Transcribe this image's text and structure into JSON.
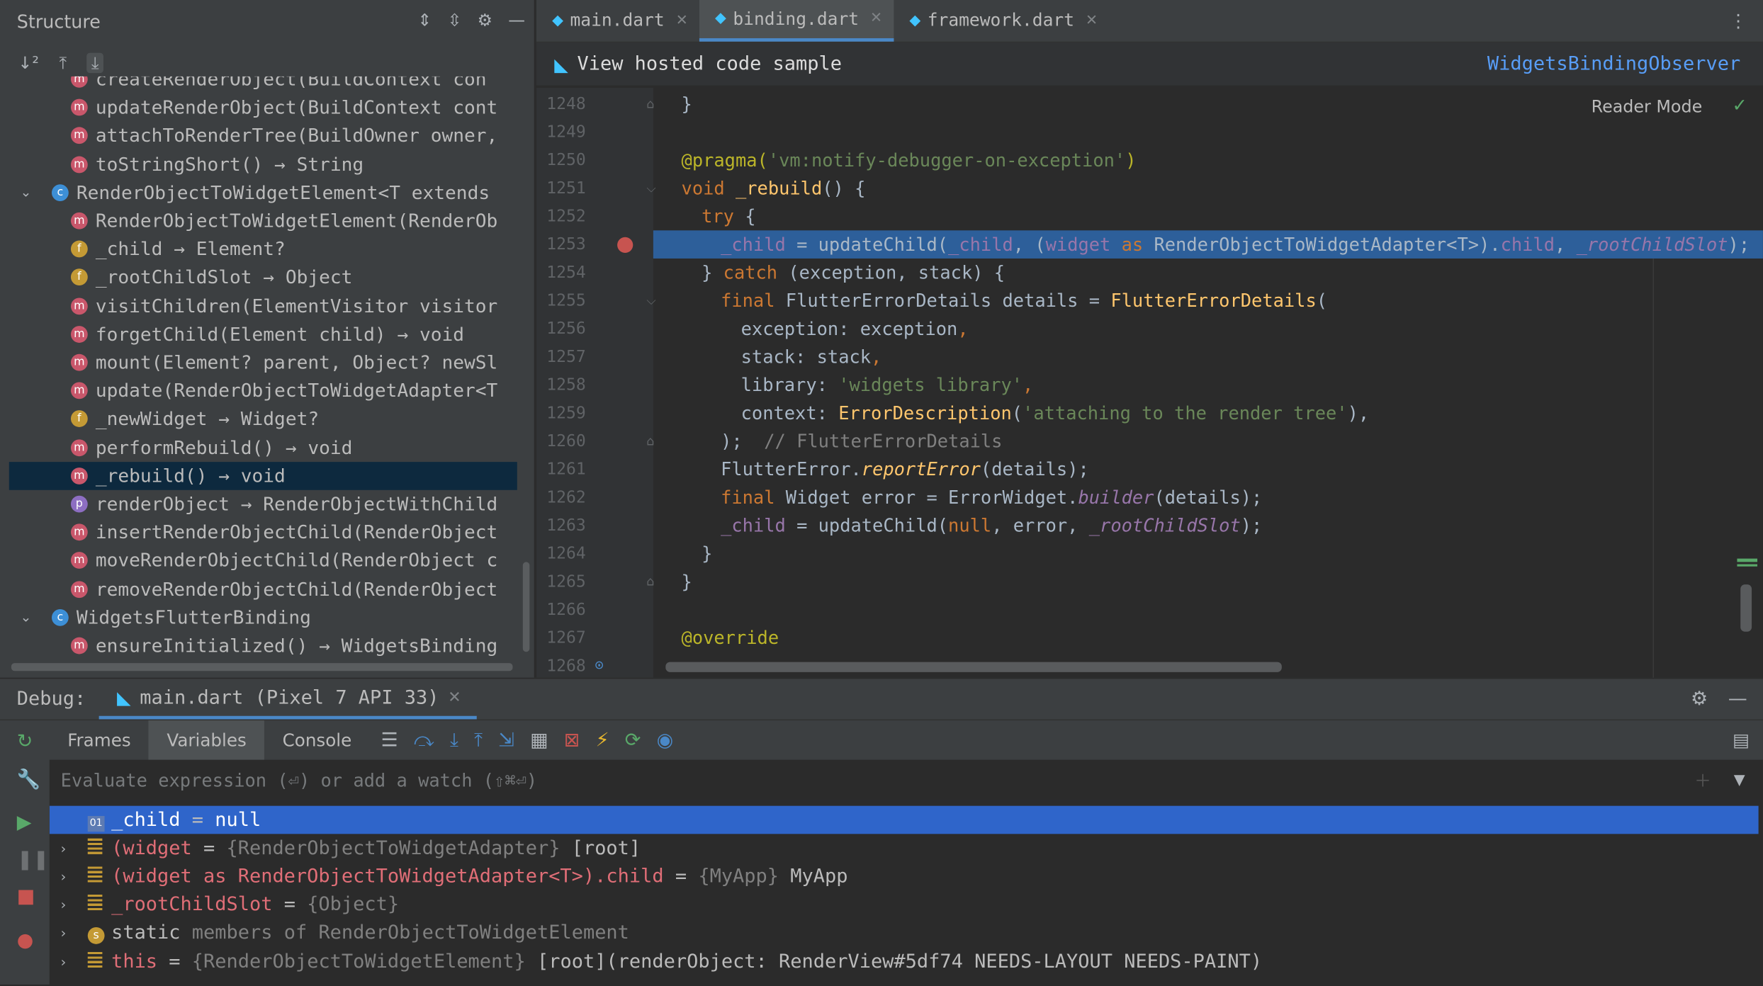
{
  "structure": {
    "title": "Structure",
    "items": [
      {
        "badge": "m",
        "text": "createRenderObject(BuildContext con"
      },
      {
        "badge": "m",
        "text": "updateRenderObject(BuildContext cont"
      },
      {
        "badge": "m",
        "text": "attachToRenderTree(BuildOwner owner,"
      },
      {
        "badge": "m",
        "text": "toStringShort() → String"
      },
      {
        "badge": "c",
        "text": "RenderObjectToWidgetElement<T extends",
        "expanded": true
      },
      {
        "badge": "m",
        "text": "RenderObjectToWidgetElement(RenderOb"
      },
      {
        "badge": "f",
        "text": "_child → Element?"
      },
      {
        "badge": "f",
        "text": "_rootChildSlot → Object"
      },
      {
        "badge": "m",
        "text": "visitChildren(ElementVisitor visitor"
      },
      {
        "badge": "m",
        "text": "forgetChild(Element child) → void"
      },
      {
        "badge": "m",
        "text": "mount(Element? parent, Object? newSl"
      },
      {
        "badge": "m",
        "text": "update(RenderObjectToWidgetAdapter<T"
      },
      {
        "badge": "f",
        "text": "_newWidget → Widget?"
      },
      {
        "badge": "m",
        "text": "performRebuild() → void"
      },
      {
        "badge": "m",
        "text": "_rebuild() → void",
        "selected": true
      },
      {
        "badge": "p",
        "text": "renderObject → RenderObjectWithChild"
      },
      {
        "badge": "m",
        "text": "insertRenderObjectChild(RenderObject"
      },
      {
        "badge": "m",
        "text": "moveRenderObjectChild(RenderObject c"
      },
      {
        "badge": "m",
        "text": "removeRenderObjectChild(RenderObject"
      },
      {
        "badge": "c",
        "text": "WidgetsFlutterBinding",
        "expanded": true
      },
      {
        "badge": "m",
        "text": "ensureInitialized() → WidgetsBinding"
      }
    ]
  },
  "editor": {
    "tabs": [
      {
        "label": "main.dart",
        "active": false
      },
      {
        "label": "binding.dart",
        "active": true
      },
      {
        "label": "framework.dart",
        "active": false
      }
    ],
    "banner": "View hosted code sample",
    "banner_link": "WidgetsBindingObserver",
    "reader_mode": "Reader Mode",
    "line_numbers": [
      "1248",
      "1249",
      "1250",
      "1251",
      "1252",
      "1253",
      "1254",
      "1255",
      "1256",
      "1257",
      "1258",
      "1259",
      "1260",
      "1261",
      "1262",
      "1263",
      "1264",
      "1265",
      "1266",
      "1267",
      "1268"
    ],
    "code": {
      "l1248": "}",
      "l1250_ann": "@pragma(",
      "l1250_str": "'vm:notify-debugger-on-exception'",
      "l1250_end": ")",
      "l1251_kw": "void",
      "l1251_fn": "_rebuild",
      "l1251_end": "() {",
      "l1252_kw": "try",
      "l1252_end": " {",
      "l1253_a": "_child",
      "l1253_b": " = updateChild(",
      "l1253_c": "_child",
      "l1253_d": ", (",
      "l1253_e": "widget",
      "l1253_f": " as ",
      "l1253_g": "RenderObjectToWidgetAdapter<T>).",
      "l1253_h": "child",
      "l1253_i": ", ",
      "l1253_j": "_rootChildSlot",
      "l1253_k": ");",
      "l1254_a": "} ",
      "l1254_kw": "catch",
      "l1254_end": " (exception, stack) {",
      "l1255_kw": "final",
      "l1255_mid": " FlutterErrorDetails details = ",
      "l1255_fn": "FlutterErrorDetails",
      "l1255_end": "(",
      "l1256_a": "exception: exception",
      "l1256_c": ",",
      "l1257_a": "stack: stack",
      "l1257_c": ",",
      "l1258_a": "library: ",
      "l1258_str": "'widgets library'",
      "l1258_c": ",",
      "l1259_a": "context: ",
      "l1259_fn": "ErrorDescription",
      "l1259_p": "(",
      "l1259_str": "'attaching to the render tree'",
      "l1259_end": "),",
      "l1260_a": ");",
      "l1260_cmt": "  // FlutterErrorDetails",
      "l1261_a": "FlutterError.",
      "l1261_fn": "reportError",
      "l1261_end": "(details);",
      "l1262_kw": "final",
      "l1262_mid": " Widget error = ErrorWidget.",
      "l1262_fn": "builder",
      "l1262_end": "(details);",
      "l1263_a": "_child",
      "l1263_b": " = updateChild(",
      "l1263_kw": "null",
      "l1263_c": ", error, ",
      "l1263_d": "_rootChildSlot",
      "l1263_end": ");",
      "l1264": "}",
      "l1265": "}",
      "l1267": "@override"
    }
  },
  "debug": {
    "label": "Debug:",
    "session": "main.dart (Pixel 7 API 33)",
    "tabs": [
      "Frames",
      "Variables",
      "Console"
    ],
    "active_tab": "Variables",
    "eval_placeholder": "Evaluate expression (⏎) or add a watch (⇧⌘⏎)",
    "variables": [
      {
        "icon": "01",
        "name": "_child",
        "eq": " = ",
        "type": "",
        "value": "null",
        "expandable": false,
        "selected": true
      },
      {
        "icon": "list",
        "name": "(widget",
        "eq": " = ",
        "type": "{RenderObjectToWidgetAdapter}",
        "value": " [root]",
        "expandable": true
      },
      {
        "icon": "list",
        "name": "(widget as RenderObjectToWidgetAdapter<T>).child",
        "eq": " = ",
        "type": "{MyApp}",
        "value": " MyApp",
        "expandable": true
      },
      {
        "icon": "list",
        "name": "_rootChildSlot",
        "eq": " = ",
        "type": "{Object}",
        "value": "",
        "expandable": true
      },
      {
        "icon": "s",
        "name": "static",
        "eq": " ",
        "type": "members of RenderObjectToWidgetElement",
        "value": "",
        "expandable": true,
        "plain_name": true
      },
      {
        "icon": "list",
        "name": "this",
        "eq": " = ",
        "type": "{RenderObjectToWidgetElement}",
        "value": " [root](renderObject: RenderView#5df74 NEEDS-LAYOUT NEEDS-PAINT)",
        "expandable": true
      }
    ]
  },
  "icons": {
    "sort": "sort-alpha-icon",
    "expand_all": "expand-all-icon",
    "collapse_all": "collapse-all-icon",
    "gear": "gear-icon",
    "minimize": "minimize-icon"
  },
  "colors": {
    "accent": "#4a88c7",
    "selection": "#2f65ca",
    "breakpoint": "#c75450"
  }
}
